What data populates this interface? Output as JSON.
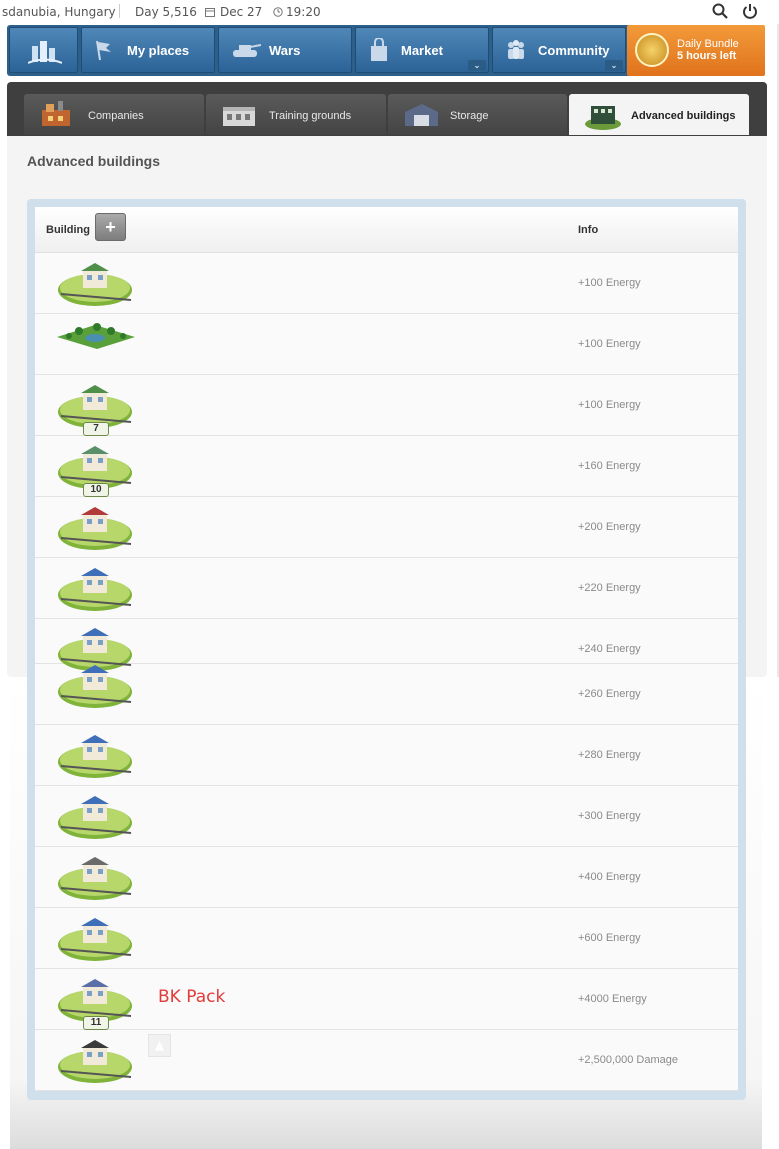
{
  "topbar": {
    "location": "sdanubia, Hungary",
    "day": "Day 5,516",
    "date": "Dec 27",
    "time": "19:20"
  },
  "nav": {
    "items": [
      {
        "label": "My places"
      },
      {
        "label": "Wars"
      },
      {
        "label": "Market"
      },
      {
        "label": "Community"
      }
    ],
    "bundle": {
      "title": "Daily Bundle",
      "subtitle": "5 hours left"
    }
  },
  "subtabs": [
    {
      "label": "Companies"
    },
    {
      "label": "Training grounds"
    },
    {
      "label": "Storage"
    },
    {
      "label": "Advanced buildings"
    }
  ],
  "page": {
    "title": "Advanced buildings"
  },
  "table": {
    "headers": {
      "building": "Building",
      "info": "Info"
    },
    "add_symbol": "+",
    "rows": [
      {
        "info": "+100 Energy",
        "badge": ""
      },
      {
        "info": "+100 Energy",
        "badge": ""
      },
      {
        "info": "+100 Energy",
        "badge": "7"
      },
      {
        "info": "+160 Energy",
        "badge": "10"
      },
      {
        "info": "+200 Energy",
        "badge": ""
      },
      {
        "info": "+220 Energy",
        "badge": ""
      },
      {
        "info": "+240 Energy",
        "badge": ""
      },
      {
        "info": "+260 Energy",
        "badge": ""
      },
      {
        "info": "+280 Energy",
        "badge": ""
      },
      {
        "info": "+300 Energy",
        "badge": ""
      },
      {
        "info": "+400 Energy",
        "badge": ""
      },
      {
        "info": "+600 Energy",
        "badge": ""
      },
      {
        "info": "+4000 Energy",
        "badge": "11",
        "note": "BK Pack"
      },
      {
        "info": "+2,500,000 Damage",
        "badge": ""
      }
    ]
  },
  "colors": {
    "nav_blue": "#2c6397",
    "bundle_orange": "#e0731c",
    "note_red": "#e23b3b"
  }
}
